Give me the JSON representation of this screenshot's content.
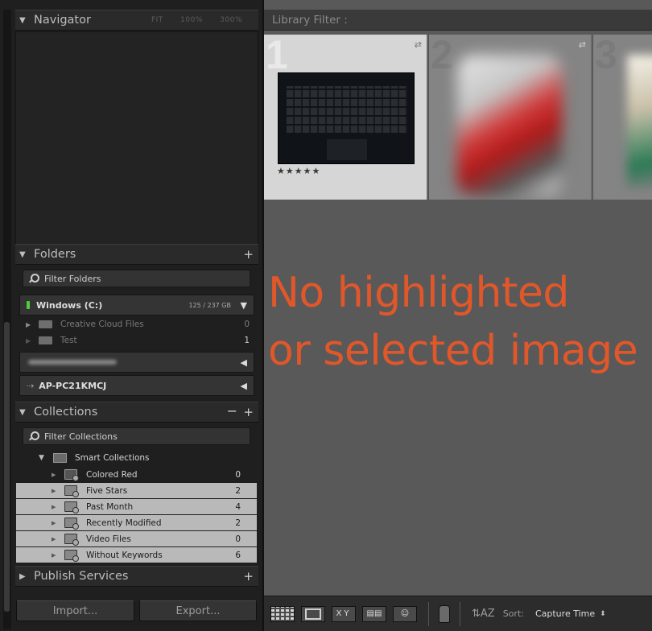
{
  "navigator": {
    "title": "Navigator",
    "zoom_options": [
      "FIT",
      "100%",
      "300%"
    ]
  },
  "folders": {
    "title": "Folders",
    "add_label": "+",
    "filter_placeholder": "Filter Folders",
    "volume": {
      "name": "Windows (C:)",
      "size": "125 / 237 GB"
    },
    "items": [
      {
        "label": "Creative Cloud Files",
        "count": "0"
      },
      {
        "label": "Test",
        "count": "1"
      }
    ],
    "network_volume": {
      "name": "AP-PC21KMCJ"
    }
  },
  "collections": {
    "title": "Collections",
    "minus_label": "−",
    "add_label": "+",
    "filter_placeholder": "Filter Collections",
    "smart_group": "Smart Collections",
    "items": [
      {
        "label": "Colored Red",
        "count": "0",
        "selected": false
      },
      {
        "label": "Five Stars",
        "count": "2",
        "selected": true
      },
      {
        "label": "Past Month",
        "count": "4",
        "selected": true
      },
      {
        "label": "Recently Modified",
        "count": "2",
        "selected": true
      },
      {
        "label": "Video Files",
        "count": "0",
        "selected": true
      },
      {
        "label": "Without Keywords",
        "count": "6",
        "selected": true
      }
    ]
  },
  "publish": {
    "title": "Publish Services",
    "add_label": "+"
  },
  "buttons": {
    "import": "Import...",
    "export": "Export..."
  },
  "library_filter": {
    "label": "Library Filter :"
  },
  "grid": {
    "cells": [
      {
        "number": "1",
        "rating": "★★★★★"
      },
      {
        "number": "2"
      },
      {
        "number": "3"
      }
    ]
  },
  "message": {
    "line1": "No highlighted",
    "line2": "or selected image"
  },
  "toolbar": {
    "sort_label": "Sort:",
    "sort_value": "Capture Time",
    "xy_label": "XY",
    "sort_icon": "A/Z sort-direction-icon"
  },
  "colors": {
    "accent_message": "#e2572a",
    "selected_row": "#b9b9b9"
  }
}
